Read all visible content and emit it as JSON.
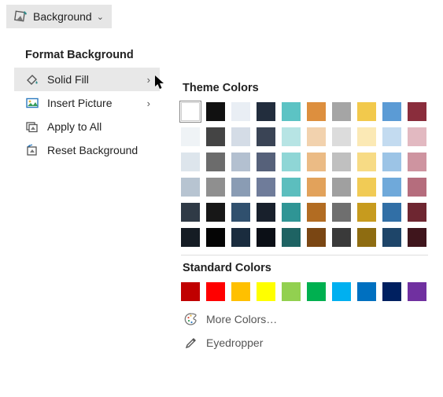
{
  "toolbar": {
    "background_label": "Background"
  },
  "menu": {
    "title": "Format Background",
    "solid_fill": "Solid Fill",
    "insert_picture": "Insert Picture",
    "apply_all": "Apply to All",
    "reset": "Reset Background"
  },
  "color_panel": {
    "theme_title": "Theme Colors",
    "standard_title": "Standard Colors",
    "more_colors": "More Colors…",
    "eyedropper": "Eyedropper",
    "theme_rows": [
      [
        "#FFFFFF",
        "#111111",
        "#E9EEF4",
        "#222D3D",
        "#5CC3C4",
        "#DD8F3E",
        "#A5A5A5",
        "#F2C94C",
        "#5B9BD5",
        "#8A2D3C"
      ],
      [
        "#EFF3F6",
        "#444444",
        "#D4DCE6",
        "#3A4455",
        "#B7E4E4",
        "#F2D2AE",
        "#DCDCDC",
        "#FBE9B5",
        "#C3DBF0",
        "#E2B9C1"
      ],
      [
        "#DDE5EC",
        "#6C6C6C",
        "#B3C0D0",
        "#56617A",
        "#8FD6D6",
        "#EBBB85",
        "#C0C0C0",
        "#F7DB85",
        "#9CC4E6",
        "#CE94A0"
      ],
      [
        "#B7C4D1",
        "#8F8F8F",
        "#8A9CB4",
        "#6F7C9A",
        "#5CBEBE",
        "#E2A25B",
        "#A0A0A0",
        "#F1CB55",
        "#6FA9DA",
        "#B56D7D"
      ],
      [
        "#2F3A46",
        "#171717",
        "#30506E",
        "#18202C",
        "#2F9595",
        "#B26C22",
        "#6F6F6F",
        "#C79B1E",
        "#316FA6",
        "#6E2631"
      ],
      [
        "#151C24",
        "#050505",
        "#1A2C3E",
        "#0B0F16",
        "#1E6363",
        "#7A4613",
        "#3A3A3A",
        "#8E6C11",
        "#1E4569",
        "#3F151C"
      ]
    ],
    "standard_colors": [
      "#C00000",
      "#FF0000",
      "#FFC000",
      "#FFFF00",
      "#92D050",
      "#00B050",
      "#00B0F0",
      "#0070C0",
      "#002060",
      "#7030A0"
    ]
  }
}
